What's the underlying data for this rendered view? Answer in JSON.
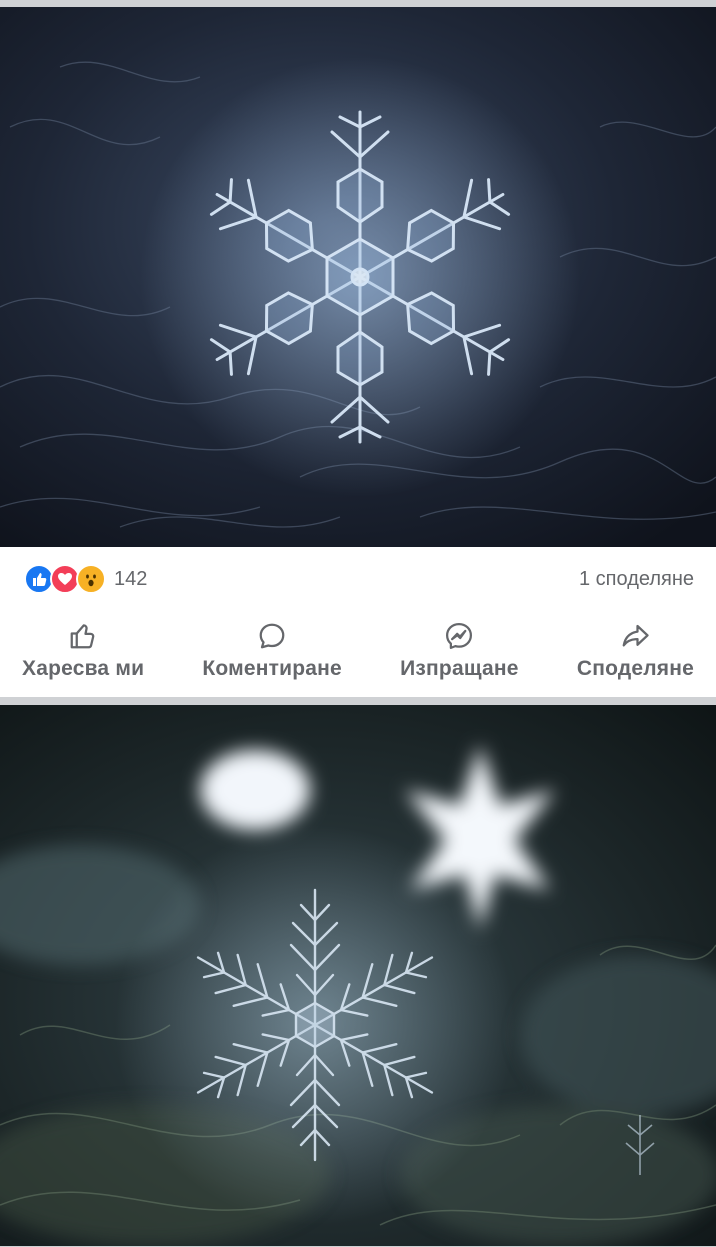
{
  "post1": {
    "image_alt": "snowflake-macro-photo-1",
    "reactions": {
      "icons": [
        "like-reaction-icon",
        "love-reaction-icon",
        "wow-reaction-icon"
      ],
      "count": "142"
    },
    "shares": "1 споделяне",
    "actions": {
      "like": "Харесва ми",
      "comment": "Коментиране",
      "send": "Изпращане",
      "share": "Споделяне"
    }
  },
  "post2": {
    "image_alt": "snowflake-macro-photo-2"
  },
  "colors": {
    "like_blue": "#1877f2",
    "love_red": "#f33e58",
    "wow_yellow": "#f7b125",
    "muted_text": "#65676b"
  }
}
